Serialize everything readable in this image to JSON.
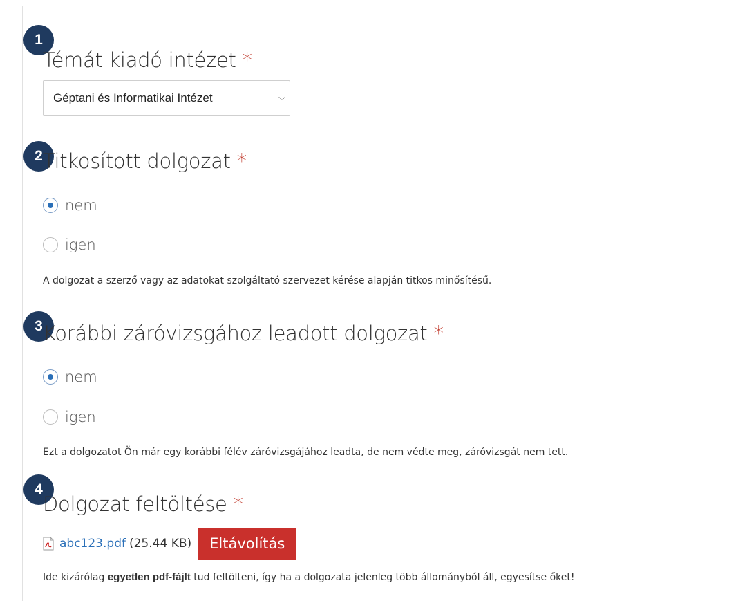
{
  "sections": [
    {
      "number": "1",
      "title": "Témát kiadó intézet",
      "required_mark": "*",
      "select_value": "Géptani és Informatikai Intézet"
    },
    {
      "number": "2",
      "title": "Titkosított dolgozat",
      "required_mark": "*",
      "options": [
        {
          "label": "nem",
          "checked": true
        },
        {
          "label": "igen",
          "checked": false
        }
      ],
      "help": "A dolgozat a szerző vagy az adatokat szolgáltató szervezet kérése alapján titkos minősítésű."
    },
    {
      "number": "3",
      "title": "Korábbi záróvizsgához leadott dolgozat",
      "required_mark": "*",
      "options": [
        {
          "label": "nem",
          "checked": true
        },
        {
          "label": "igen",
          "checked": false
        }
      ],
      "help": "Ezt a dolgozatot Ön már egy korábbi félév záróvizsgájához leadta, de nem védte meg, záróvizsgát nem tett."
    },
    {
      "number": "4",
      "title": "Dolgozat feltöltése",
      "required_mark": "*",
      "file": {
        "icon": "pdf-file-icon",
        "name": "abc123.pdf",
        "size": "(25.44 KB)",
        "remove_label": "Eltávolítás"
      },
      "help_parts": {
        "before": "Ide kizárólag ",
        "bold": "egyetlen pdf-fájlt",
        "after": " tud feltölteni, így ha a dolgozata jelenleg több állományból áll, egyesítse őket!"
      }
    }
  ],
  "colors": {
    "badge": "#1f3a5f",
    "required": "#c0392b",
    "link": "#2a6fb8",
    "remove_button": "#c9302c"
  }
}
